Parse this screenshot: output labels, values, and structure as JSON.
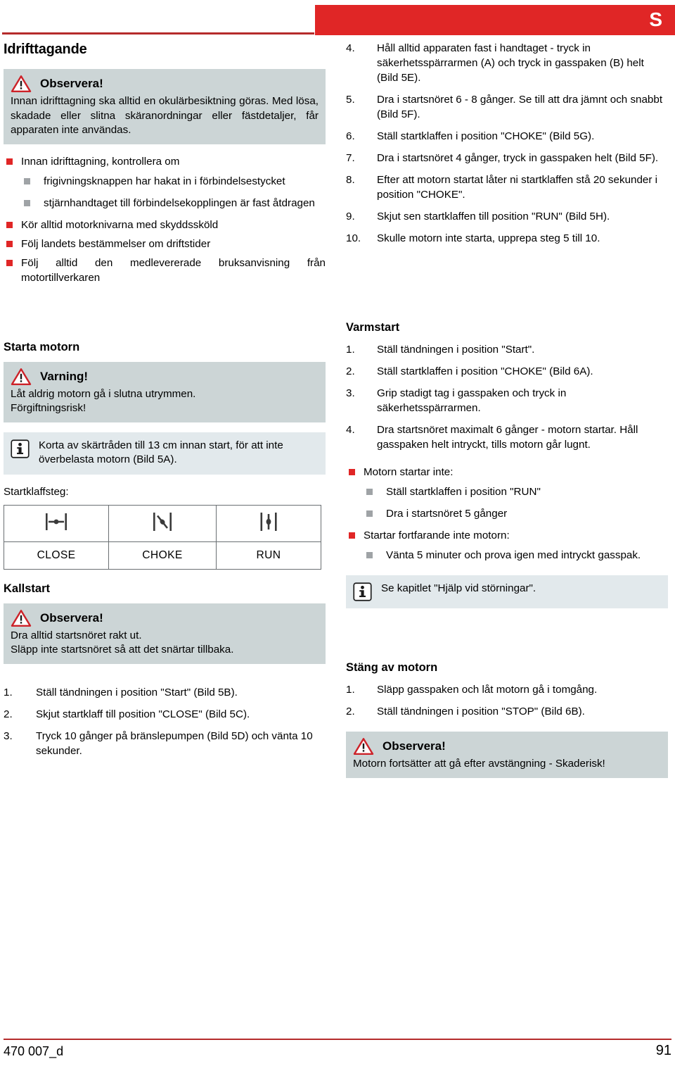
{
  "header": {
    "language_letter": "S",
    "accent_red": "#e02626",
    "rule_red": "#b52b2b"
  },
  "left_column": {
    "section_title": "Idrifttagande",
    "notice_1": {
      "icon": "warning-triangle-icon",
      "title": "Observera!",
      "body": "Innan idrifttagning ska alltid en okulärbesiktning göras. Med lösa, skadade eller slitna skäranordningar eller fästdetaljer, får apparaten inte användas."
    },
    "checklist": [
      {
        "text": "Innan idrifttagning, kontrollera om",
        "sub": [
          "frigivningsknappen har hakat in i förbindelsestycket",
          "stjärnhandtaget till förbindelsekopplingen är fast åtdragen"
        ]
      },
      {
        "text": "Kör alltid motorknivarna med skyddssköld",
        "sub": []
      },
      {
        "text": "Följ landets bestämmelser om driftstider",
        "sub": []
      },
      {
        "text": "Följ alltid den medlevererade bruksanvisning från motortillverkaren",
        "sub": []
      }
    ],
    "start_engine": {
      "title": "Starta motorn",
      "notice": {
        "icon": "warning-triangle-icon",
        "title": "Varning!",
        "lines": [
          "Låt aldrig motorn gå i slutna utrymmen.",
          "Förgiftningsrisk!"
        ]
      },
      "info": {
        "icon": "info-icon",
        "text": "Korta av skärtråden till 13 cm innan start, för att inte överbelasta motorn (Bild 5A)."
      },
      "table_label": "Startklaffsteg:",
      "choke_table": {
        "columns": [
          {
            "icon": "choke-close-icon",
            "label": "CLOSE"
          },
          {
            "icon": "choke-choke-icon",
            "label": "CHOKE"
          },
          {
            "icon": "choke-run-icon",
            "label": "RUN"
          }
        ]
      }
    },
    "cold_start": {
      "title": "Kallstart",
      "notice": {
        "icon": "warning-triangle-icon",
        "title": "Observera!",
        "lines": [
          "Dra alltid startsnöret rakt ut.",
          "Släpp inte startsnöret så att det snärtar tillbaka."
        ]
      },
      "steps": [
        {
          "num": "1.",
          "text": "Ställ tändningen i position \"Start\" (Bild 5B)."
        },
        {
          "num": "2.",
          "text": "Skjut startklaff till position \"CLOSE\" (Bild 5C)."
        },
        {
          "num": "3.",
          "text": "Tryck 10 gånger på bränslepumpen (Bild 5D) och vänta 10 sekunder."
        }
      ]
    }
  },
  "right_column": {
    "cold_start_continued": [
      {
        "num": "4.",
        "text": "Håll alltid apparaten fast i handtaget - tryck in säkerhetsspärrarmen (A) och tryck in gasspaken (B) helt (Bild 5E)."
      },
      {
        "num": "5.",
        "text": "Dra i startsnöret 6 - 8 gånger. Se till att dra jämnt och snabbt (Bild 5F)."
      },
      {
        "num": "6.",
        "text": "Ställ startklaffen i position \"CHOKE\" (Bild 5G)."
      },
      {
        "num": "7.",
        "text": "Dra i startsnöret 4 gånger, tryck in gasspaken helt (Bild 5F)."
      },
      {
        "num": "8.",
        "text": "Efter att motorn startat låter ni startklaffen stå 20 sekunder i position \"CHOKE\"."
      },
      {
        "num": "9.",
        "text": "Skjut sen startklaffen till position \"RUN\" (Bild 5H)."
      },
      {
        "num": "10.",
        "text": "Skulle motorn inte starta, upprepa steg 5 till 10."
      }
    ],
    "warm_start": {
      "title": "Varmstart",
      "steps": [
        {
          "num": "1.",
          "text": "Ställ tändningen i position \"Start\"."
        },
        {
          "num": "2.",
          "text": "Ställ startklaffen i position \"CHOKE\" (Bild 6A)."
        },
        {
          "num": "3.",
          "text": "Grip stadigt tag i gasspaken och tryck in säkerhetsspärrarmen."
        },
        {
          "num": "4.",
          "text": "Dra startsnöret maximalt 6 gånger - motorn startar. Håll gasspaken helt intryckt, tills motorn går lugnt."
        }
      ],
      "troubleshoot": [
        {
          "text": "Motorn startar inte:",
          "sub": [
            "Ställ startklaffen i position \"RUN\"",
            "Dra i startsnöret 5 gånger"
          ]
        },
        {
          "text": "Startar fortfarande inte motorn:",
          "sub": [
            "Vänta 5 minuter och prova igen med intryckt gasspak."
          ]
        }
      ],
      "info": {
        "icon": "info-icon",
        "text": "Se kapitlet \"Hjälp vid störningar\"."
      }
    },
    "stop_engine": {
      "title": "Stäng av motorn",
      "steps": [
        {
          "num": "1.",
          "text": "Släpp gasspaken och låt motorn gå i tomgång."
        },
        {
          "num": "2.",
          "text": "Ställ tändningen i position \"STOP\" (Bild 6B)."
        }
      ],
      "notice": {
        "icon": "warning-triangle-icon",
        "title": "Observera!",
        "lines": [
          "Motorn fortsätter att gå efter avstängning - Skaderisk!"
        ]
      }
    }
  },
  "footer": {
    "doc_number": "470 007_d",
    "page_number": "91"
  }
}
